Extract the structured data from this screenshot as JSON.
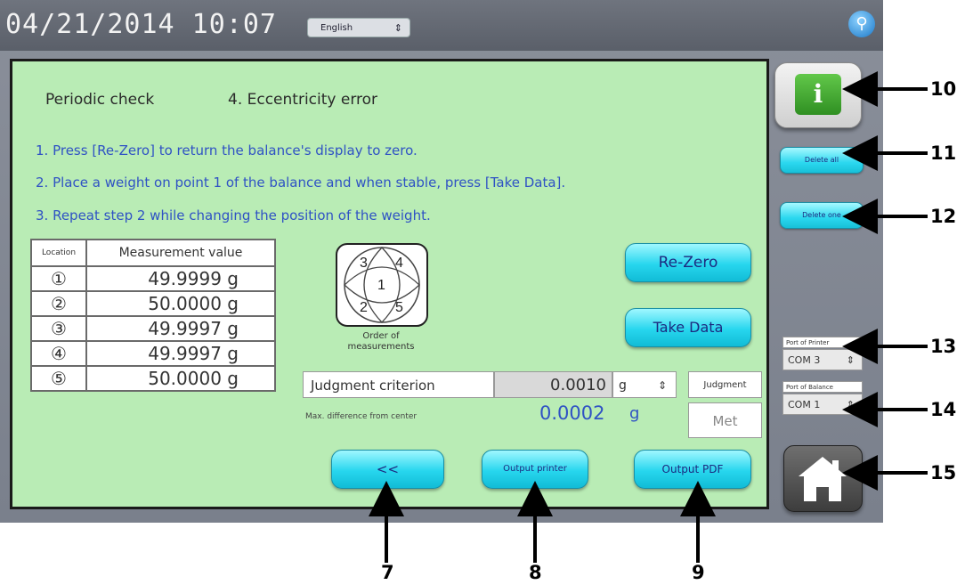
{
  "header": {
    "datetime": "04/21/2014  10:07",
    "language": "English"
  },
  "panel": {
    "title_left": "Periodic check",
    "title_right": "4. Eccentricity error",
    "steps": [
      "1. Press [Re-Zero] to return the balance's display to zero.",
      "2. Place a weight on point 1 of the balance and when stable, press [Take Data].",
      "3. Repeat step 2 while changing the position of the weight."
    ],
    "table": {
      "headers": [
        "Location",
        "Measurement value"
      ],
      "rows": [
        {
          "loc": "①",
          "value": "49.9999 g"
        },
        {
          "loc": "②",
          "value": "50.0000 g"
        },
        {
          "loc": "③",
          "value": "49.9997 g"
        },
        {
          "loc": "④",
          "value": "49.9997 g"
        },
        {
          "loc": "⑤",
          "value": "50.0000 g"
        }
      ]
    },
    "order_points": [
      "3",
      "4",
      "1",
      "2",
      "5"
    ],
    "order_caption": "Order of measurements",
    "rezero_label": "Re-Zero",
    "takedata_label": "Take Data",
    "criterion_label": "Judgment criterion",
    "criterion_value": "0.0010",
    "criterion_unit": "g",
    "judgment_label": "Judgment",
    "judgment_value": "Met",
    "maxdiff_label": "Max. difference from center",
    "maxdiff_value": "0.0002",
    "maxdiff_unit": "g",
    "back_label": "<<",
    "output_printer_label": "Output printer",
    "output_pdf_label": "Output PDF"
  },
  "side": {
    "delete_all_label": "Delete all",
    "delete_one_label": "Delete one",
    "printer_port_label": "Port of Printer",
    "printer_port_value": "COM 3",
    "balance_port_label": "Port of Balance",
    "balance_port_value": "COM 1",
    "info_icon": "info-icon",
    "home_icon": "home-icon"
  },
  "callouts": [
    "7",
    "8",
    "9",
    "10",
    "11",
    "12",
    "13",
    "14",
    "15"
  ]
}
